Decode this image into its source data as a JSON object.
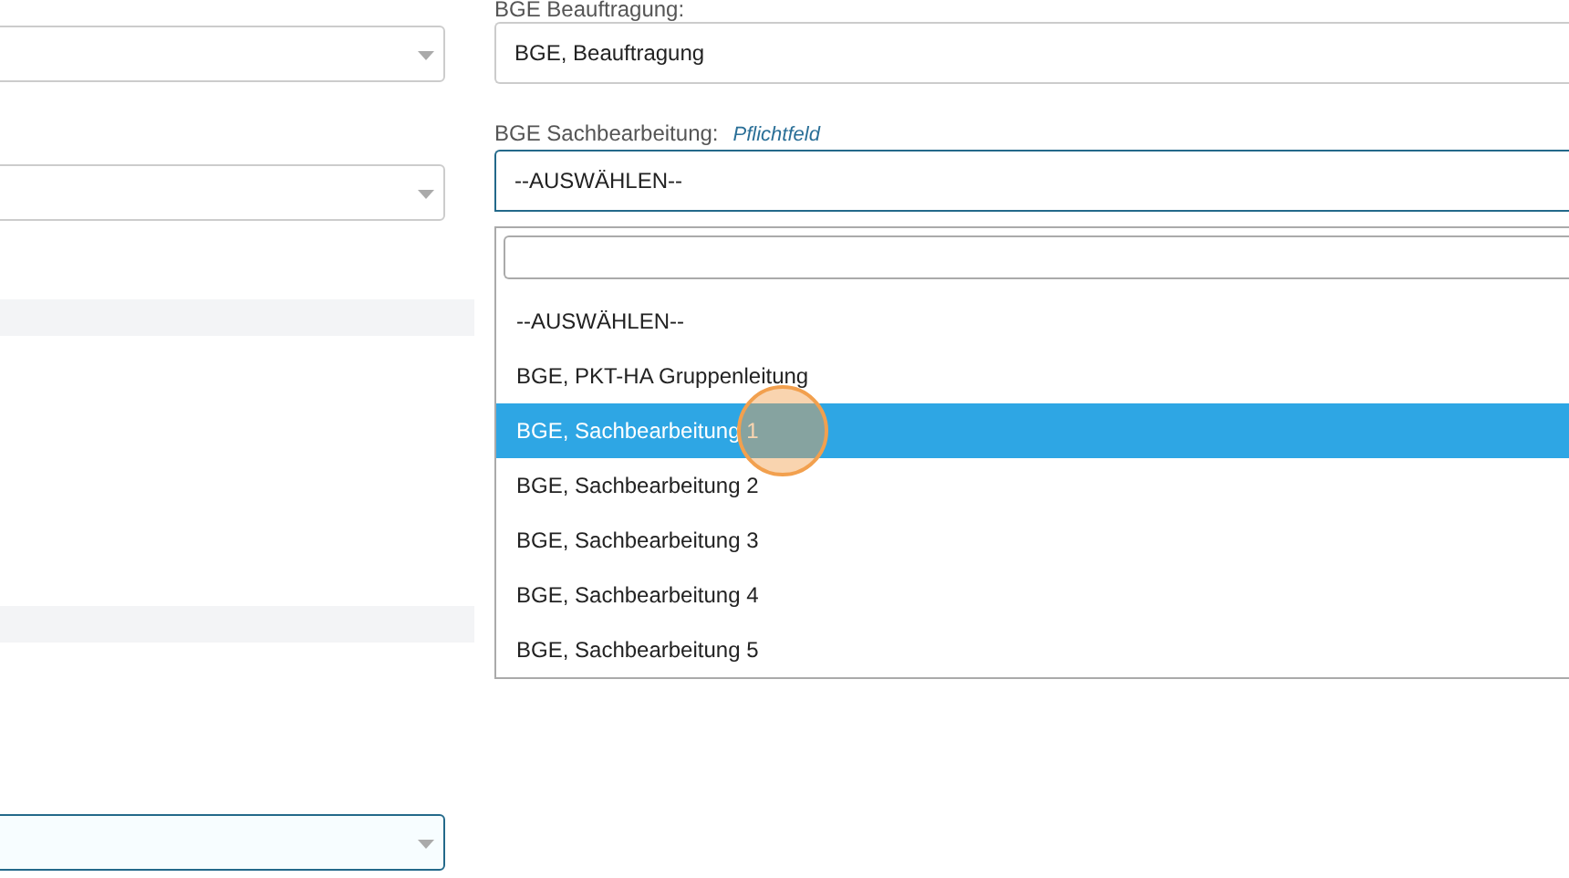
{
  "left_column": {
    "selects": [
      {
        "focused": false
      },
      {
        "focused": false
      },
      {
        "focused": true
      }
    ]
  },
  "assignment_field": {
    "label": "BGE Beauftragung:",
    "value": "BGE, Beauftragung"
  },
  "processing_select": {
    "label": "BGE Sachbearbeitung:",
    "hint": "Pflichtfeld",
    "value": "--AUSWÄHLEN--",
    "expanded": true,
    "options": [
      {
        "label": "--AUSWÄHLEN--",
        "highlighted": false
      },
      {
        "label": "BGE, PKT-HA Gruppenleitung",
        "highlighted": false
      },
      {
        "label": "BGE, Sachbearbeitung 1",
        "highlighted": true
      },
      {
        "label": "BGE, Sachbearbeitung 2",
        "highlighted": false
      },
      {
        "label": "BGE, Sachbearbeitung 3",
        "highlighted": false
      },
      {
        "label": "BGE, Sachbearbeitung 4",
        "highlighted": false
      },
      {
        "label": "BGE, Sachbearbeitung 5",
        "highlighted": false
      }
    ]
  }
}
